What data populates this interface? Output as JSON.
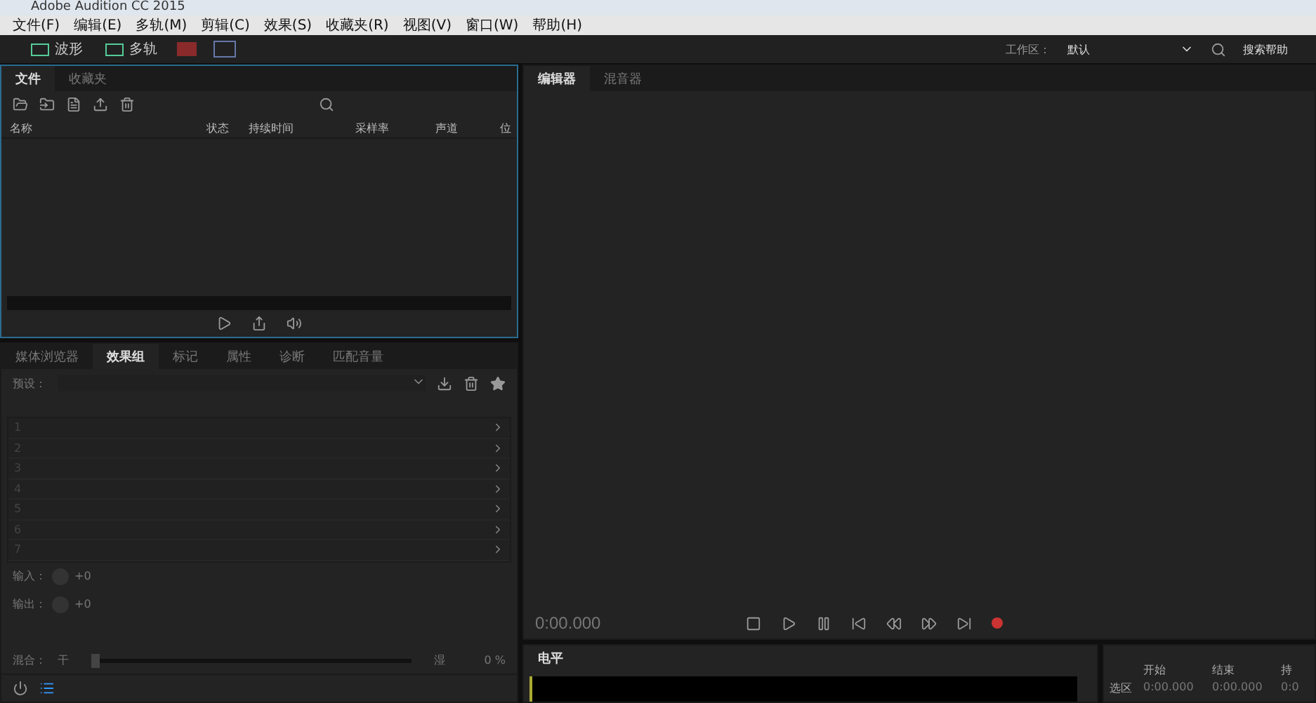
{
  "window": {
    "title": "Adobe Audition CC 2015"
  },
  "menu": [
    "文件(F)",
    "编辑(E)",
    "多轨(M)",
    "剪辑(C)",
    "效果(S)",
    "收藏夹(R)",
    "视图(V)",
    "窗口(W)",
    "帮助(H)"
  ],
  "modes": [
    {
      "label": "波形",
      "selected": false
    },
    {
      "label": "多轨",
      "selected": false
    }
  ],
  "workspace": {
    "label": "工作区：",
    "value": "默认",
    "search": "搜索帮助"
  },
  "files_panel": {
    "tabs": [
      {
        "label": "文件",
        "selected": true
      },
      {
        "label": "收藏夹",
        "selected": false
      }
    ],
    "columns": [
      "名称",
      "状态",
      "持续时间",
      "采样率",
      "声道",
      "位"
    ]
  },
  "effects_panel": {
    "tabs": [
      {
        "label": "媒体浏览器",
        "selected": false
      },
      {
        "label": "效果组",
        "selected": true
      },
      {
        "label": "标记",
        "selected": false
      },
      {
        "label": "属性",
        "selected": false
      },
      {
        "label": "诊断",
        "selected": false
      },
      {
        "label": "匹配音量",
        "selected": false
      }
    ],
    "preset_label": "预设：",
    "slots": [
      "1",
      "2",
      "3",
      "4",
      "5",
      "6",
      "7"
    ],
    "input": {
      "label": "输入：",
      "value": "+0"
    },
    "output": {
      "label": "输出：",
      "value": "+0"
    },
    "mix": {
      "label": "混合：",
      "dry": "干",
      "wet": "湿",
      "reading": "0 %",
      "level": 0
    }
  },
  "editor_panel": {
    "tabs": [
      {
        "label": "编辑器",
        "selected": true
      },
      {
        "label": "混音器",
        "selected": false
      }
    ],
    "time": "0:00.000",
    "record_armed": true
  },
  "levels_panel": {
    "title": "电平"
  },
  "selection_panel": {
    "columns": [
      "开始",
      "结束",
      "持"
    ],
    "rows": [
      {
        "label": "选区",
        "start": "0:00.000",
        "end": "0:00.000",
        "duration": "0:0"
      }
    ]
  }
}
